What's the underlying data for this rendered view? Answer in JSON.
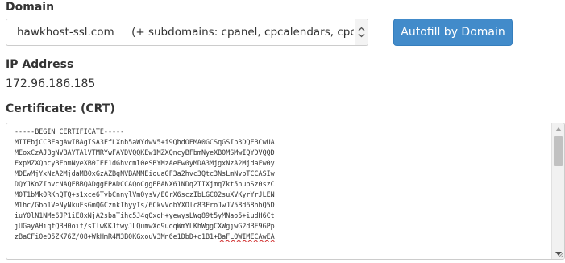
{
  "domain": {
    "label": "Domain",
    "selected": "hawkhost-ssl.com     (+ subdomains: cpanel, cpcalendars, cpcontacts, mail, webdisk, webmail, www)",
    "autofill_button": "Autofill by Domain"
  },
  "ip": {
    "label": "IP Address",
    "value": "172.96.186.185"
  },
  "certificate": {
    "label": "Certificate: (CRT)",
    "lines": [
      "-----BEGIN CERTIFICATE-----",
      "MIIFbjCCBFagAwIBAgISA3FfLXnb5aWYdwV5+i9QhdOEMA0GCSqGSIb3DQEBCwUA",
      "MEoxCzAJBgNVBAYTAlVTMRYwFAYDVQQKEw1MZXQncyBFbmNyeXB0MSMwIQYDVQQD",
      "ExpMZXQncyBFbmNyeXB0IEF1dGhvcml0eSBYMzAeFw0yMDA3MjgxNzA2MjdaFw0y",
      "MDEwMjYxNzA2MjdaMB0xGzAZBgNVBAMMEiouaGF3a2hvc3Qtc3NsLmNvbTCCASIw",
      "DQYJKoZIhvcNAQEBBQADggEPADCCAQoCggEBANX61NDq2TIXjmq7kt5nubSz0szC",
      "M0T1bMk0RKnQTQ+s1xce6TvbCnnylVm0ysV/E0rX6sczIbLGC02suXVKyrYrJLEN",
      "M1hc/Gbo1VeNyNkuEsGmQGCznkIhyyIs/6CkvVobYXOlc83FroJwJV58d68hbQ5D",
      "iuY0lN1NMe6JP1iE8xNjA2sbaTihc5J4qOxqH+yewysLWq89t5yMNao5+iudH6Ct",
      "jUGayAHiqfQBH0oif/sTlwKKJtwyJLQumwXq9uoqWmYLKhWggCXWgjwG2dBF9GPp",
      "zBaCFi0eO5ZK76Z/08+WkHmR4M3B0KGxouV3Mn6e1DbD+c1B1+"
    ],
    "last_line_tail": "BaFLOWIMECAwEA"
  }
}
